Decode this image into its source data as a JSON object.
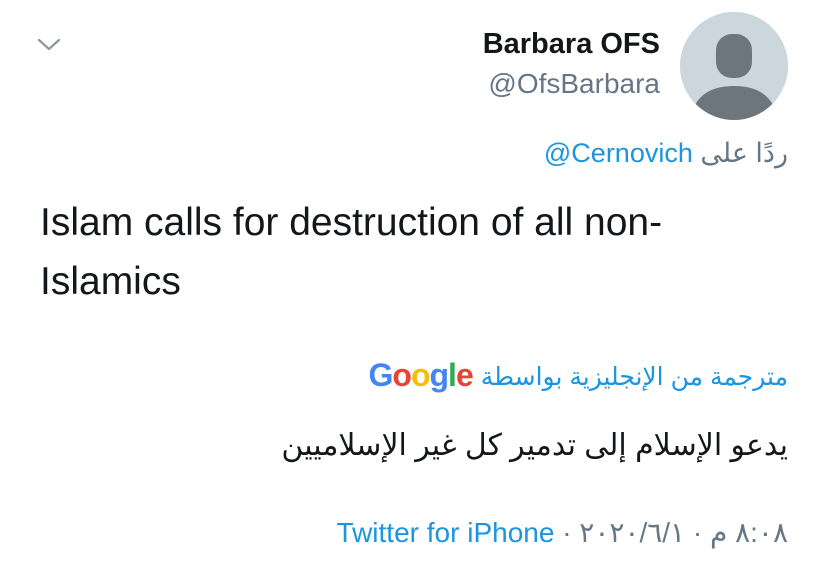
{
  "header": {
    "name": "Barbara OFS",
    "handle": "@OfsBarbara",
    "menu_icon": "chevron-down-icon",
    "avatar_icon": "default-avatar-icon"
  },
  "reply": {
    "prefix": "ردًا على",
    "mention": "@Cernovich"
  },
  "tweet": {
    "text": "Islam calls for destruction of all non-Islamics"
  },
  "translation": {
    "label": "مترجمة من الإنجليزية بواسطة",
    "provider_logo": {
      "G": "G",
      "o1": "o",
      "o2": "o",
      "g": "g",
      "l": "l",
      "e": "e"
    },
    "text": "يدعو الإسلام إلى تدمير كل غير الإسلاميين"
  },
  "meta": {
    "timestamp": "٨:٠٨ م · ٢٠٢٠/٦/١",
    "separator": "·",
    "source": "Twitter for iPhone"
  },
  "colors": {
    "link": "#1b95e0",
    "secondary_text": "#657786",
    "primary_text": "#14171a",
    "avatar_bg": "#ccd6dd",
    "avatar_fg": "#6e767d"
  }
}
